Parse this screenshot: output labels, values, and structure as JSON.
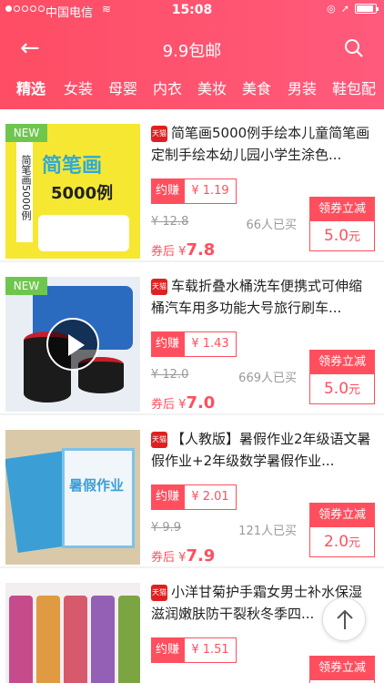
{
  "status_bar": {
    "carrier": "中国电信",
    "time": "15:08"
  },
  "nav": {
    "title": "9.9包邮"
  },
  "categories": [
    "精选",
    "女装",
    "母婴",
    "内衣",
    "美妆",
    "美食",
    "男装",
    "鞋包配"
  ],
  "colors": {
    "accent": "#fe4d64",
    "price": "#ff4f5e",
    "new_badge": "#6fc64f",
    "tmall": "#e02020"
  },
  "products": [
    {
      "badge": "NEW",
      "tmall": "天猫",
      "title": "简笔画5000例手绘本儿童简笔画定制手绘本幼儿园小学生涂色...",
      "earn_label": "约赚",
      "earn_value": "¥ 1.19",
      "original": "¥ 12.8",
      "sold": "66人已买",
      "after_label": "券后",
      "after_currency": "¥",
      "after_price": "7.8",
      "coupon_label": "领券立减",
      "coupon_value": "5.0",
      "coupon_unit": "元",
      "thumb_label": "简笔画",
      "thumb_sub": "5000例"
    },
    {
      "badge": "NEW",
      "tmall": "天猫",
      "title": "车载折叠水桶洗车便携式可伸缩桶汽车用多功能大号旅行刷车...",
      "earn_label": "约赚",
      "earn_value": "¥ 1.43",
      "original": "¥ 12.0",
      "sold": "669人已买",
      "after_label": "券后",
      "after_currency": "¥",
      "after_price": "7.0",
      "coupon_label": "领券立减",
      "coupon_value": "5.0",
      "coupon_unit": "元"
    },
    {
      "badge": "",
      "tmall": "天猫",
      "title": "【人教版】暑假作业2年级语文暑假作业+2年级数学暑假作业...",
      "earn_label": "约赚",
      "earn_value": "¥ 2.01",
      "original": "¥ 9.9",
      "sold": "121人已买",
      "after_label": "券后",
      "after_currency": "¥",
      "after_price": "7.9",
      "coupon_label": "领券立减",
      "coupon_value": "2.0",
      "coupon_unit": "元",
      "thumb_label": "暑假作业"
    },
    {
      "badge": "",
      "tmall": "天猫",
      "title": "小洋甘菊护手霜女男士补水保湿滋润嫩肤防干裂秋冬季四...",
      "earn_label": "约赚",
      "earn_value": "¥ 1.51",
      "original": "",
      "sold": "",
      "after_label": "",
      "after_currency": "",
      "after_price": "",
      "coupon_label": "领券立减",
      "coupon_value": "",
      "coupon_unit": ""
    }
  ]
}
